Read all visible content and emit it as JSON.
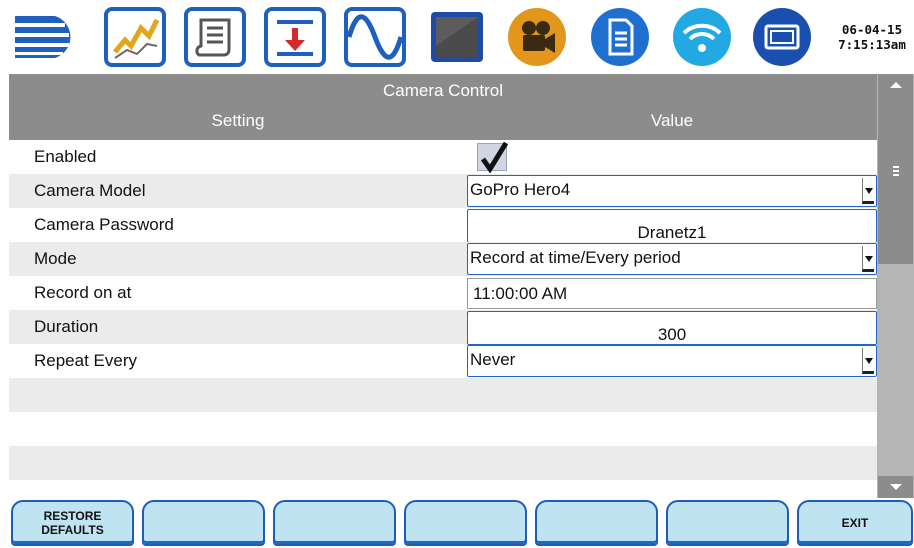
{
  "toolbar": {
    "icons": [
      "menu-icon",
      "trend-chart-icon",
      "scroll-log-icon",
      "download-icon",
      "waveform-icon",
      "display-icon",
      "video-camera-icon",
      "document-icon",
      "wifi-icon",
      "window-icon"
    ],
    "date": "06-04-15",
    "time": "7:15:13am"
  },
  "panel": {
    "title": "Camera Control",
    "col_setting": "Setting",
    "col_value": "Value",
    "rows": [
      {
        "label": "Enabled",
        "type": "checkbox",
        "checked": true
      },
      {
        "label": "Camera Model",
        "type": "select",
        "value": "GoPro Hero4"
      },
      {
        "label": "Camera Password",
        "type": "text",
        "value": "Dranetz1"
      },
      {
        "label": "Mode",
        "type": "select",
        "value": "Record at time/Every period"
      },
      {
        "label": "Record on at",
        "type": "field",
        "value": "11:00:00 AM"
      },
      {
        "label": "Duration",
        "type": "text",
        "value": "300"
      },
      {
        "label": "Repeat Every",
        "type": "select",
        "value": "Never"
      }
    ]
  },
  "softkeys": {
    "restore": "RESTORE\nDEFAULTS",
    "key2": "",
    "key3": "",
    "key4": "",
    "key5": "",
    "key6": "",
    "exit": "EXIT"
  },
  "colors": {
    "header_gray": "#8c8c8c",
    "accent_blue": "#2563c7",
    "softkey_fill": "#bfe3f1",
    "row_shade": "#ebebeb"
  }
}
